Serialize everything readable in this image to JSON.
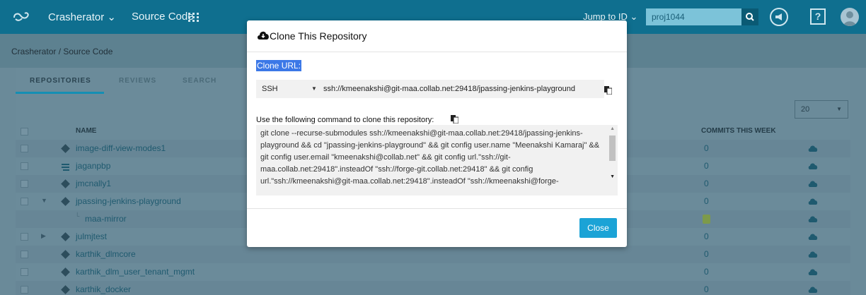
{
  "topbar": {
    "project": "Crasherator ⌄",
    "source_code": "Source Code",
    "jump_to_id": "Jump to ID ⌄",
    "search_value": "proj1044",
    "help": "?"
  },
  "breadcrumb": "Crasherator / Source Code",
  "tabs": [
    "REPOSITORIES",
    "REVIEWS",
    "SEARCH"
  ],
  "pager": {
    "value": "20"
  },
  "table": {
    "col_name": "NAME",
    "col_commits": "COMMITS THIS WEEK",
    "rows": [
      {
        "name": "image-diff-view-modes1",
        "commits": "0"
      },
      {
        "name": "jaganpbp",
        "commits": "0"
      },
      {
        "name": "jmcnally1",
        "commits": "0"
      },
      {
        "name": "jpassing-jenkins-playground",
        "commits": "0"
      },
      {
        "name": "maa-mirror",
        "commits": ""
      },
      {
        "name": "julmjtest",
        "commits": "0"
      },
      {
        "name": "karthik_dlmcore",
        "commits": "0"
      },
      {
        "name": "karthik_dlm_user_tenant_mgmt",
        "commits": "0"
      },
      {
        "name": "karthik_docker",
        "commits": "0"
      }
    ]
  },
  "modal": {
    "title": "Clone This Repository",
    "clone_url_label": "Clone URL:",
    "protocol": "SSH",
    "url": "ssh://kmeenakshi@git-maa.collab.net:29418/jpassing-jenkins-playground",
    "command_label": "Use the following command to clone this repository:",
    "command": "git clone --recurse-submodules ssh://kmeenakshi@git-maa.collab.net:29418/jpassing-jenkins-playground && cd \"jpassing-jenkins-playground\" && git config user.name \"Meenakshi Kamaraj\" && git config user.email \"kmeenakshi@collab.net\" && git config url.\"ssh://git-maa.collab.net:29418\".insteadOf \"ssh://forge-git.collab.net:29418\" && git config url.\"ssh://kmeenakshi@git-maa.collab.net:29418\".insteadOf \"ssh://kmeenakshi@forge-",
    "close_label": "Close"
  },
  "colors": {
    "topbar": "#0f6f8f",
    "accent": "#1ba3d6",
    "selection": "#3b78e7"
  }
}
